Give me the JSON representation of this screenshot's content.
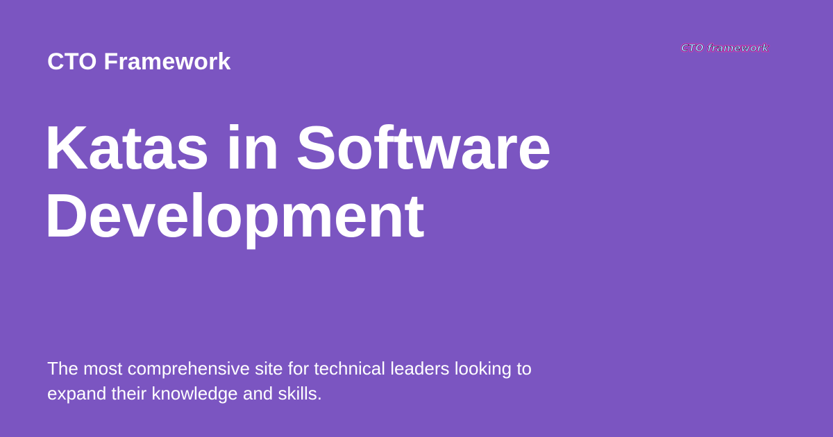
{
  "card": {
    "background_color": "#7b55c1",
    "text_color": "#ffffff"
  },
  "site": {
    "name": "CTO Framework"
  },
  "logo": {
    "text": "CTO framework",
    "fill_color": "#a8c4ff",
    "outline_color": "#e040c8"
  },
  "title": {
    "lines": [
      "Katas in Software",
      "Development"
    ]
  },
  "description": {
    "lines": [
      "The most comprehensive site for technical leaders looking to",
      "expand their knowledge and skills."
    ]
  }
}
